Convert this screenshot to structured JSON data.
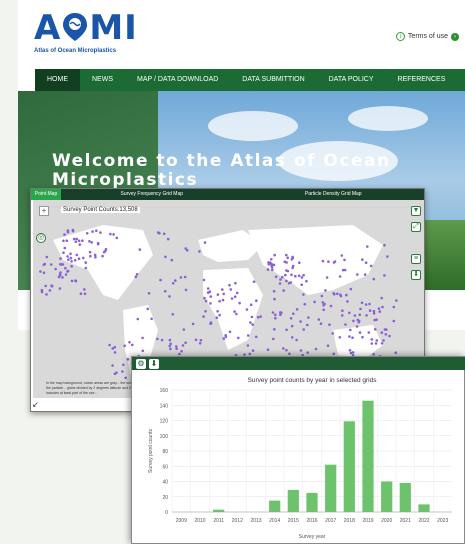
{
  "header": {
    "logo_text": "AOMI",
    "logo_subtitle": "Atlas of Ocean Microplastics",
    "terms_label": "Terms of use"
  },
  "nav": {
    "items": [
      "HOME",
      "NEWS",
      "MAP / DATA DOWNLOAD",
      "DATA SUBMITTION",
      "DATA POLICY",
      "REFERENCES"
    ]
  },
  "hero": {
    "title": "Welcome to the Atlas of Ocean Microplastics"
  },
  "map_window": {
    "tabs": [
      "Point Map",
      "Survey Frequency Grid Map",
      "Particle Density Grid Map"
    ],
    "point_count": "Survey Point Counts:13,508",
    "caption": "In the map background, ocean areas are gray... the survey frequency grid map and the particle... globe divided by 2 degrees latitude and 2 degr... land area that includes at least part of the oce..."
  },
  "colors": {
    "nav_green": "#1c6b34",
    "brand_blue": "#1b55a8",
    "point_purple": "#8b5fd6",
    "bar_green": "#6cc36c"
  },
  "chart_data": {
    "type": "bar",
    "title": "Survey point counts by year in selected grids",
    "xlabel": "Survey year",
    "ylabel": "Survey point counts",
    "categories": [
      "2009",
      "2010",
      "2011",
      "2012",
      "2013",
      "2014",
      "2015",
      "2016",
      "2017",
      "2018",
      "2019",
      "2020",
      "2021",
      "2022",
      "2023"
    ],
    "values": [
      0,
      0,
      3,
      0,
      0,
      15,
      29,
      25,
      62,
      119,
      146,
      40,
      38,
      10,
      0
    ],
    "ylim": [
      0,
      160
    ],
    "yticks": [
      0,
      20,
      40,
      60,
      80,
      100,
      120,
      140,
      160
    ],
    "grid": true
  }
}
